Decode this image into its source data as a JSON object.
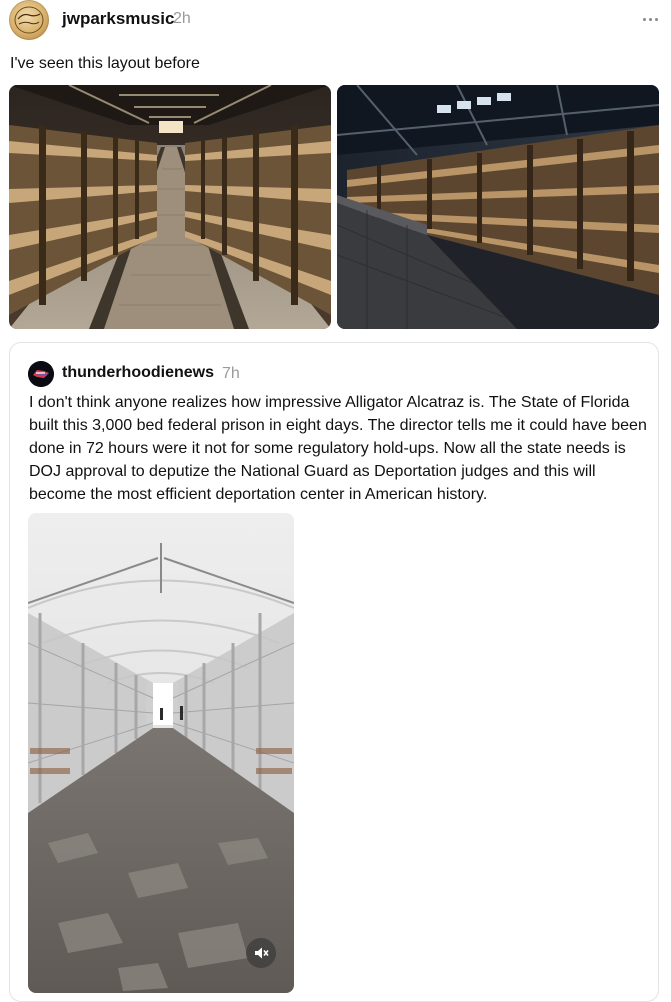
{
  "post": {
    "username": "jwparksmusic",
    "timestamp": "2h",
    "text": "I've seen this layout before",
    "avatar_icon": "profile-avatar",
    "more_icon": "more-options-icon",
    "images": [
      {
        "icon": "barracks-photo"
      },
      {
        "icon": "barracks-photo"
      }
    ]
  },
  "quoted_post": {
    "username": "thunderhoodienews",
    "timestamp": "7h",
    "text": "I don't think anyone realizes how impressive Alligator Alcatraz is. The State of Florida built this 3,000 bed federal prison in eight days. The director tells me it could have been done in 72 hours were it not for some regulatory hold-ups. Now all the state needs is DOJ approval to deputize the National Guard as Deportation judges and this will become the most efficient deportation center in American history.",
    "avatar_icon": "profile-avatar",
    "video": {
      "icon": "tent-facility-video",
      "mute_icon": "speaker-muted-icon"
    }
  },
  "colors": {
    "text_primary": "#111111",
    "text_secondary": "#9a9a9a",
    "card_border": "#e3e3e3"
  }
}
